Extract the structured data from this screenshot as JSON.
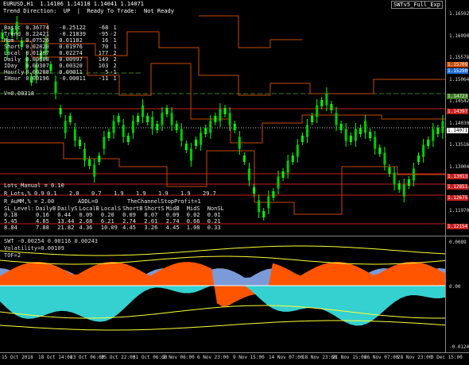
{
  "header": {
    "symbol_line": "EURUSD,H1  1.14106 1.14118 1.14041 1.14071",
    "status_line": "Trend Direction:  UP  |  Ready To Trade:  Not Ready",
    "ea_badge": "SWTv5_Full_Exp"
  },
  "stats_table": {
    "rows": [
      [
        "Basic",
        "0.36774",
        "-0.25122",
        "-68",
        "1"
      ],
      [
        "Trend",
        "0.22421",
        "-0.21839",
        "-95",
        "-2"
      ],
      [
        "Mom",
        "0.07526",
        "0.01182",
        "16",
        "1"
      ],
      [
        "Short",
        "0.02820",
        "0.01976",
        "70",
        "1"
      ],
      [
        "Local",
        "0.01287",
        "0.02274",
        "177",
        "2"
      ],
      [
        "Daily",
        "0.00688",
        "0.00997",
        "149",
        "2"
      ],
      [
        "IDay",
        "0.00307",
        "0.00320",
        "103",
        "2"
      ],
      [
        "Hourly",
        "0.00208",
        "0.00011",
        "5",
        "-1"
      ],
      [
        "IHour",
        "0.00196",
        "-0.00011",
        "-11",
        "1"
      ]
    ],
    "v_line": "V=0.00318"
  },
  "lower_block": {
    "lots": "Lots_Manual = 0.10",
    "r_lots_row": [
      "R_Lots,%",
      "0.9",
      "0.1",
      "2.0",
      "0.7",
      "1.9",
      "1.9",
      "1.9",
      "1.9",
      "29.7"
    ],
    "r_aumm": "R_AuMM,% = 2.00",
    "addl": "ADDL=0",
    "channel": "TheChannelStopProfit=1",
    "sl_header": [
      "SL_Level:",
      "DailyB",
      "DailyS",
      "LocalB",
      "LocalS",
      "ShortB",
      "ShortS",
      "MidB",
      "MidS",
      "NonSL"
    ],
    "sl_rows": [
      [
        "0.18",
        "0.16",
        "0.44",
        "0.09",
        "0.20",
        "0.09",
        "0.07",
        "0.09",
        "0.02",
        "0.01"
      ],
      [
        "5.45",
        "4.85",
        "13.44",
        "2.68",
        "6.21",
        "2.74",
        "2.01",
        "2.74",
        "0.66",
        "0.21"
      ],
      [
        "8.84",
        "7.88",
        "21.82",
        "4.36",
        "10.09",
        "4.45",
        "3.26",
        "4.45",
        "1.08",
        "0.33"
      ]
    ]
  },
  "price_axis": {
    "ticks": [
      "1.16592",
      "1.16090",
      "1.15578",
      "1.15064",
      "1.14542",
      "1.14030",
      "1.13516",
      "1.13004",
      "1.12482",
      "1.11970"
    ],
    "tags": [
      {
        "label": "1.15709",
        "color": "#c84a00"
      },
      {
        "label": "1.15290",
        "color": "#1e6fd9"
      },
      {
        "label": "1.14723",
        "color": "#3a7d20"
      },
      {
        "label": "1.14397",
        "color": "#c81e1e"
      },
      {
        "label": "1.14071",
        "color": "#ffffff"
      },
      {
        "label": "1.13013",
        "color": "#c81e1e"
      },
      {
        "label": "1.12851",
        "color": "#c81e1e"
      },
      {
        "label": "1.12675",
        "color": "#c81e1e"
      },
      {
        "label": "1.12154",
        "color": "#c81e1e"
      }
    ]
  },
  "indicator": {
    "header": "SWT -0.00254 0.00116 0.00243",
    "volatility": "Volatility=0.00109",
    "tof": "TOF=2",
    "axis_ticks": [
      "0.0089",
      "0.00",
      "-0.01246"
    ]
  },
  "time_axis": {
    "labels": [
      "15 Oct 2018",
      "18 Oct 14:00",
      "23 Oct 06:00",
      "25 Oct 22:00",
      "31 Oct 06:00",
      "2 Nov 06:00",
      "6 Nov 23:00",
      "9 Nov 15:00",
      "14 Nov 07:00",
      "18 Nov 23:00",
      "21 Nov 15:00",
      "26 Nov 07:00",
      "28 Nov 23:00",
      "3 Dec 15:00"
    ]
  },
  "colors": {
    "bull_candle": "#00ff00",
    "bear_candle": "#00cc00",
    "level_red": "#c81e1e",
    "level_orange": "#c84a00",
    "level_green": "#3a7d20",
    "osc_orange": "#ff5500",
    "osc_cyan": "#35d0d0",
    "osc_blue": "#7b9ad8",
    "osc_yellow": "#ffff33"
  }
}
